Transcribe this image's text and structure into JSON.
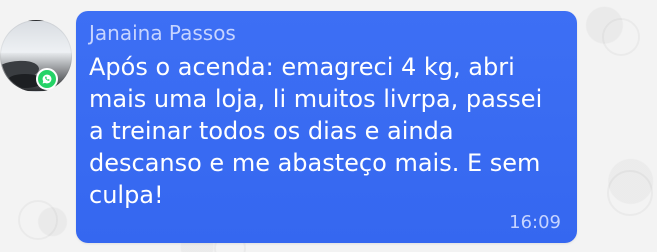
{
  "message": {
    "sender_name": "Janaina Passos",
    "text": "Após o acenda: emagreci 4 kg, abri\nmais uma loja, li muitos livrpa, passei\na treinar todos os dias e ainda\ndescanso e me abasteço mais. E sem\nculpa!",
    "timestamp": "16:09"
  },
  "icons": {
    "badge": "whatsapp-icon"
  },
  "colors": {
    "bubble": "#3567f0",
    "badge": "#25d366",
    "text": "#ffffff",
    "meta": "#c6d4ff"
  }
}
